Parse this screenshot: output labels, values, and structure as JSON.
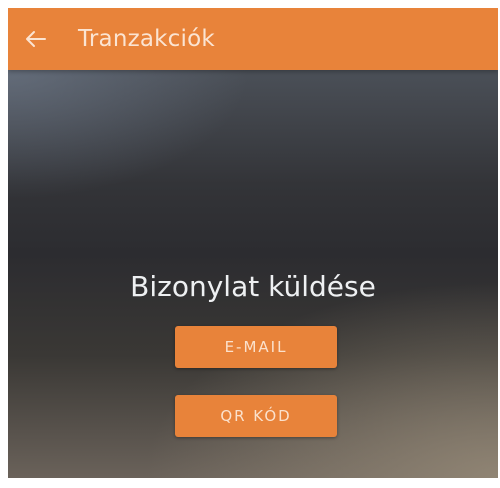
{
  "header": {
    "back_icon": "arrow-left-icon",
    "title": "Tranzakciók"
  },
  "main": {
    "send_title": "Bizonylat küldése",
    "email_button_label": "E-MAIL",
    "qr_button_label": "QR KÓD"
  },
  "colors": {
    "accent": "#e8833a",
    "title_text": "#eef0f2"
  }
}
